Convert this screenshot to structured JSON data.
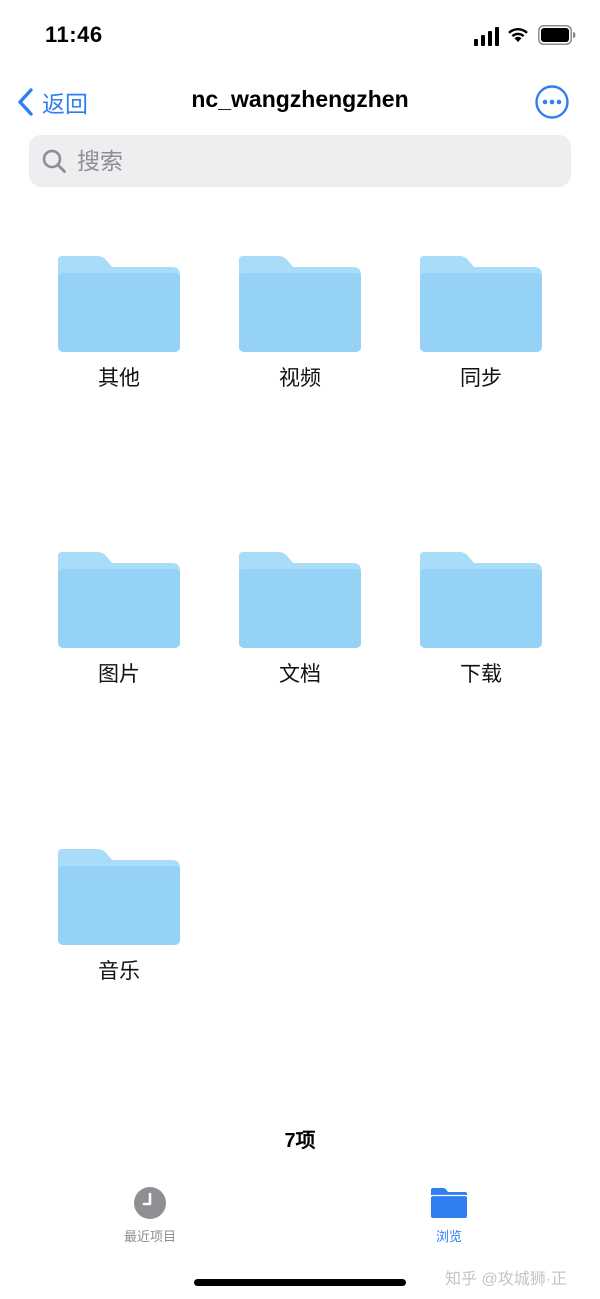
{
  "status_bar": {
    "time": "11:46",
    "signal_icon": "cellular-signal-icon",
    "wifi_icon": "wifi-icon",
    "battery_icon": "battery-icon"
  },
  "nav": {
    "back_label": "返回",
    "back_icon": "chevron-left-icon",
    "title": "nc_wangzhengzhen",
    "more_icon": "ellipsis-circle-icon"
  },
  "search": {
    "placeholder": "搜索",
    "icon": "search-icon"
  },
  "folders": [
    {
      "label": "其他",
      "icon": "folder-icon"
    },
    {
      "label": "视频",
      "icon": "folder-icon"
    },
    {
      "label": "同步",
      "icon": "folder-icon"
    },
    {
      "label": "图片",
      "icon": "folder-icon"
    },
    {
      "label": "文档",
      "icon": "folder-icon"
    },
    {
      "label": "下载",
      "icon": "folder-icon"
    },
    {
      "label": "音乐",
      "icon": "folder-icon"
    }
  ],
  "item_count": "7项",
  "tab_bar": {
    "tabs": [
      {
        "label": "最近项目",
        "icon": "clock-icon",
        "selected": false
      },
      {
        "label": "浏览",
        "icon": "folder-icon",
        "selected": true
      }
    ]
  },
  "watermark": "知乎 @攻城狮·正",
  "colors": {
    "accent": "#2f7ef2",
    "folder_light": "#a9dcf9",
    "folder_body": "#96d2f6",
    "search_bg": "#eeeef0",
    "inactive_tab": "#8e8e93"
  }
}
